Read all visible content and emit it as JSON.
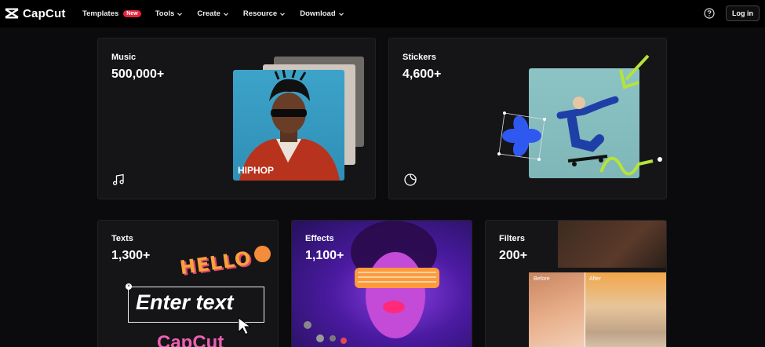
{
  "nav": {
    "logo_text": "CapCut",
    "menu": [
      {
        "label": "Templates",
        "badge": "New"
      },
      {
        "label": "Tools"
      },
      {
        "label": "Create"
      },
      {
        "label": "Resource"
      },
      {
        "label": "Download"
      }
    ],
    "login_label": "Log in",
    "help_icon": "question-circle-icon"
  },
  "cards": {
    "music": {
      "title": "Music",
      "count": "500,000+",
      "genre_label": "HIPHOP",
      "icon": "music-note-icon"
    },
    "stickers": {
      "title": "Stickers",
      "count": "4,600+",
      "icon": "sticker-icon"
    },
    "texts": {
      "title": "Texts",
      "count": "1,300+",
      "sample_hello": "HELLO",
      "sample_input": "Enter text",
      "sample_brand": "CapCut"
    },
    "effects": {
      "title": "Effects",
      "count": "1,100+"
    },
    "filters": {
      "title": "Filters",
      "count": "200+",
      "before_label": "Before",
      "after_label": "After"
    }
  },
  "colors": {
    "background": "#0b0b0d",
    "card": "#151518",
    "badge": "#e5253b",
    "accent_green": "#b5e33a"
  }
}
